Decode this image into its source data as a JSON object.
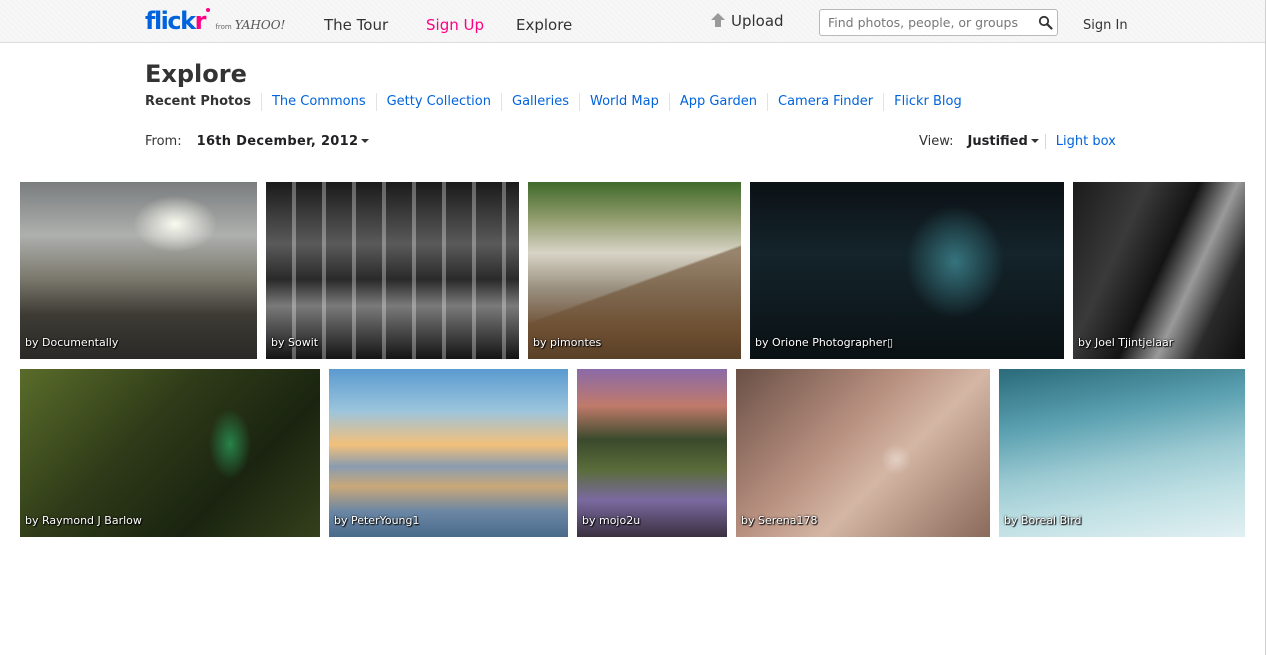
{
  "header": {
    "logo_text": "flickr",
    "logo_from": "from",
    "logo_yahoo": "YAHOO!",
    "nav": {
      "tour": "The Tour",
      "signup": "Sign Up",
      "explore": "Explore"
    },
    "upload": "Upload",
    "search_placeholder": "Find photos, people, or groups",
    "signin": "Sign In"
  },
  "page": {
    "title": "Explore",
    "subnav": [
      "Recent Photos",
      "The Commons",
      "Getty Collection",
      "Galleries",
      "World Map",
      "App Garden",
      "Camera Finder",
      "Flickr Blog"
    ],
    "from_label": "From:",
    "from_date": "16th December, 2012",
    "view_label": "View:",
    "view_selected": "Justified",
    "view_lightbox": "Light box"
  },
  "photos": [
    {
      "credit": "by Documentally"
    },
    {
      "credit": "by Sowit"
    },
    {
      "credit": "by pimontes"
    },
    {
      "credit": "by Orione Photographer▯"
    },
    {
      "credit": "by Joel Tjintjelaar"
    },
    {
      "credit": "by Raymond J Barlow"
    },
    {
      "credit": "by PeterYoung1"
    },
    {
      "credit": "by mojo2u"
    },
    {
      "credit": "by Serena178"
    },
    {
      "credit": "by Boreal Bird"
    }
  ],
  "colors": {
    "brand_blue": "#0063dc",
    "brand_pink": "#ff0084",
    "link": "#0063dc"
  }
}
